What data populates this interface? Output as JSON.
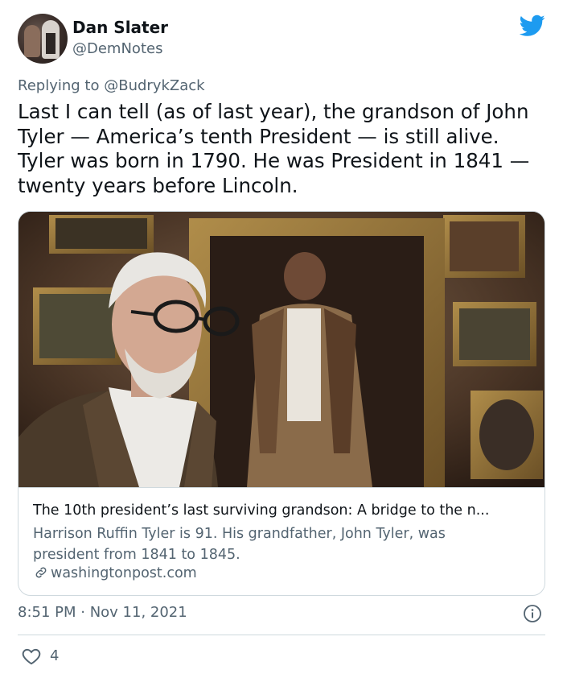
{
  "author": {
    "name": "Dan Slater",
    "handle": "@DemNotes"
  },
  "reply": {
    "prefix": "Replying to",
    "target": "@BudrykZack"
  },
  "tweet": {
    "text": "Last I can tell (as of last year), the grandson of John Tyler — America’s tenth President — is still alive. Tyler was born in 1790. He was President in 1841 — twenty years before Lincoln."
  },
  "card": {
    "title": "The 10th president’s last surviving grandson: A bridge to the n...",
    "description": "Harrison Ruffin Tyler is 91. His grandfather, John Tyler, was president from 1841 to 1845.",
    "domain": "washingtonpost.com"
  },
  "meta": {
    "timestamp": "8:51 PM · Nov 11, 2021",
    "likes": "4"
  },
  "colors": {
    "twitter_blue": "#1d9bf0",
    "secondary_text": "#536471",
    "border": "#cfd9de"
  },
  "icons": [
    "twitter-bird-icon",
    "link-icon",
    "info-icon",
    "heart-icon"
  ]
}
